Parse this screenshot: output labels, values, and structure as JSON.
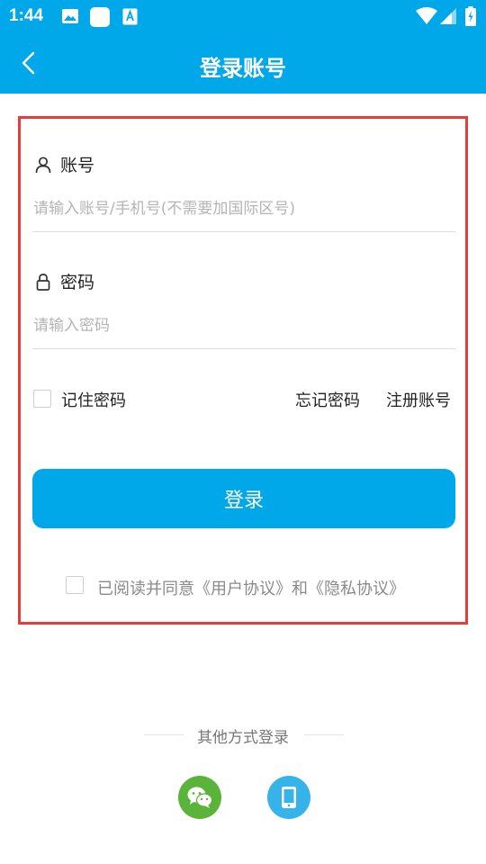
{
  "status_bar": {
    "time": "1:44"
  },
  "app_bar": {
    "title": "登录账号"
  },
  "account": {
    "label": "账号",
    "placeholder": "请输入账号/手机号(不需要加国际区号)",
    "value": ""
  },
  "password": {
    "label": "密码",
    "placeholder": "请输入密码",
    "value": ""
  },
  "options": {
    "remember": "记住密码",
    "forgot": "忘记密码",
    "register": "注册账号"
  },
  "login_button": "登录",
  "agreement": "已阅读并同意《用户协议》和《隐私协议》",
  "other_login": {
    "title": "其他方式登录"
  },
  "colors": {
    "primary": "#00a8ea",
    "wechat": "#5bb43a",
    "phone": "#36b4e9",
    "highlight": "#e53c3c"
  }
}
